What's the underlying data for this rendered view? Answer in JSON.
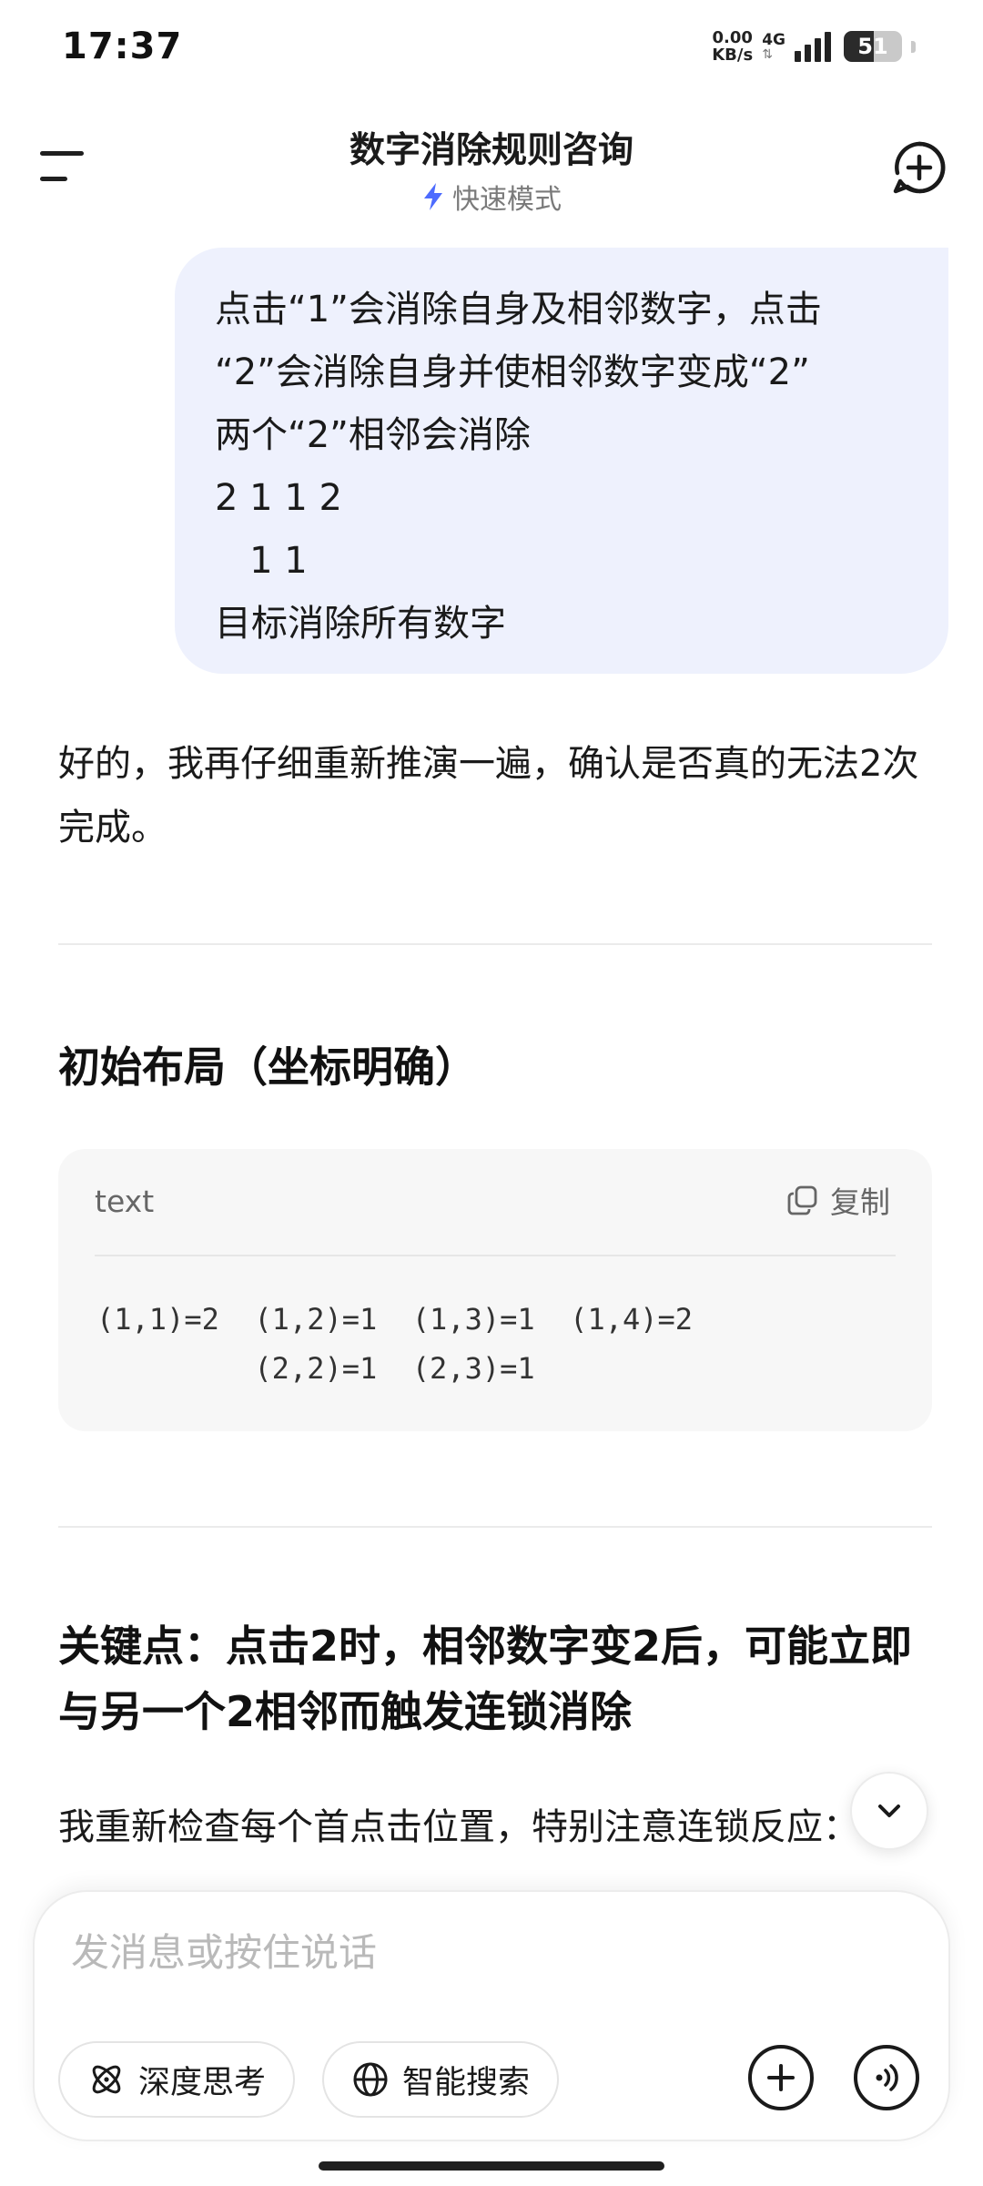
{
  "status_bar": {
    "time": "17:37",
    "net_speed_value": "0.00",
    "net_speed_unit": "KB/s",
    "network_type": "4G",
    "battery_level": "51"
  },
  "header": {
    "title": "数字消除规则咨询",
    "mode_label": "快速模式",
    "mode_icon": "lightning-bolt-icon",
    "menu_icon": "menu-icon",
    "new_chat_icon": "new-chat-icon"
  },
  "user_message": {
    "lines": [
      "点击“1”会消除自身及相邻数字，点击",
      "“2”会消除自身并使相邻数字变成“2”",
      "两个“2”相邻会消除",
      "2 1 1 2",
      "   1 1",
      "目标消除所有数字"
    ]
  },
  "assistant": {
    "intro": "好的，我再仔细重新推演一遍，确认是否真的无法2次完成。",
    "section1_heading": "初始布局（坐标明确）",
    "code_block": {
      "language": "text",
      "copy_label": "复制",
      "lines": [
        "(1,1)=2  (1,2)=1  (1,3)=1  (1,4)=2",
        "         (2,2)=1  (2,3)=1"
      ]
    },
    "section2_heading": "关键点：点击2时，相邻数字变2后，可能立即与另一个2相邻而触发连锁消除",
    "body": "我重新检查每个首点击位置，特别注意连锁反应："
  },
  "composer": {
    "placeholder": "发消息或按住说话",
    "deep_think_label": "深度思考",
    "smart_search_label": "智能搜索"
  },
  "colors": {
    "bubble_bg": "#eef1fd",
    "accent_blue": "#4d6bfe",
    "code_bg": "#f7f7f7"
  }
}
